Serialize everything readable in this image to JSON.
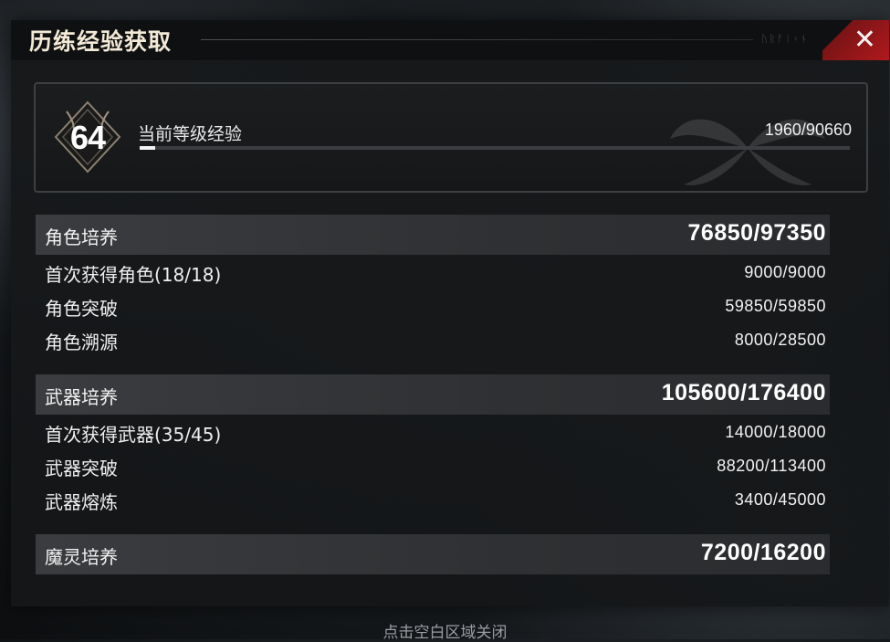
{
  "dialog": {
    "title": "历练经验获取",
    "close_icon": "close-icon",
    "accent_color": "#b0191c"
  },
  "level": {
    "number": "64",
    "label": "当前等级经验",
    "value": "1960/90660",
    "progress": 0.0216
  },
  "sections": [
    {
      "title": "角色培养",
      "value": "76850/97350",
      "items": [
        {
          "label": "首次获得角色(18/18)",
          "value": "9000/9000"
        },
        {
          "label": "角色突破",
          "value": "59850/59850"
        },
        {
          "label": "角色溯源",
          "value": "8000/28500"
        }
      ]
    },
    {
      "title": "武器培养",
      "value": "105600/176400",
      "items": [
        {
          "label": "首次获得武器(35/45)",
          "value": "14000/18000"
        },
        {
          "label": "武器突破",
          "value": "88200/113400"
        },
        {
          "label": "武器熔炼",
          "value": "3400/45000"
        }
      ]
    },
    {
      "title": "魔灵培养",
      "value": "7200/16200",
      "items": []
    }
  ],
  "hint": "点击空白区域关闭"
}
